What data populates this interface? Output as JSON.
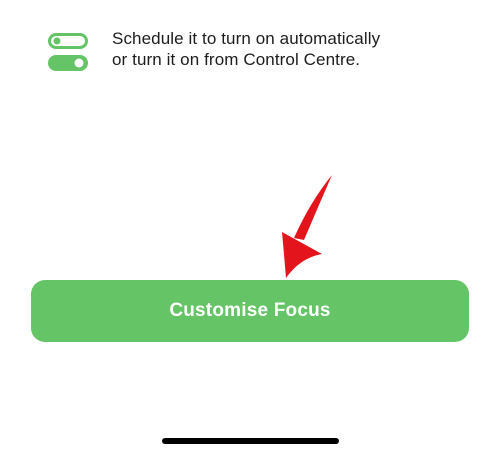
{
  "colors": {
    "accent_green": "#65c466",
    "arrow_red": "#e3141b"
  },
  "feature": {
    "icon": "toggles-icon",
    "lines": [
      "Schedule it to turn on automatically",
      "or turn it on from Control Centre."
    ]
  },
  "annotation": {
    "icon": "red-arrow-icon"
  },
  "button": {
    "label": "Customise Focus"
  }
}
